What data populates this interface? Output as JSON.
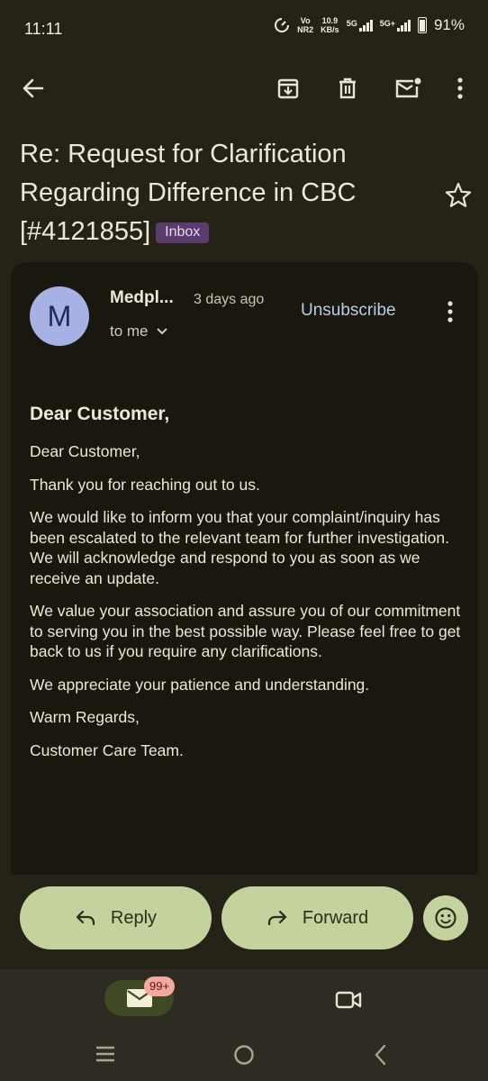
{
  "status_bar": {
    "time": "11:11",
    "volte_top": "Vo",
    "volte_bottom": "NR2",
    "speed_top": "10.9",
    "speed_bottom": "KB/s",
    "net1": "5G",
    "net2": "5G+",
    "battery": "91%"
  },
  "toolbar": {
    "back_icon": "arrow-left-icon",
    "archive_icon": "archive-icon",
    "delete_icon": "trash-icon",
    "unread_icon": "mark-unread-icon",
    "more_icon": "more-vertical-icon"
  },
  "email": {
    "subject": "Re: Request for Clarification Regarding Difference in CBC [#4121855]",
    "label": "Inbox",
    "avatar_letter": "M",
    "sender": "Medpl...",
    "time_ago": "3 days ago",
    "recipient": "to me",
    "unsubscribe": "Unsubscribe",
    "heading": "Dear Customer,",
    "paragraphs": [
      "Dear Customer,",
      "Thank you for reaching out to us.",
      "We would like to inform you that your complaint/inquiry has been escalated to the relevant team for further investigation. We will acknowledge and respond to you as soon as we receive an update.",
      "We value your association and assure you of our commitment to serving you in the best possible way. Please feel free to get back to us if you require any clarifications.",
      "We appreciate your patience and understanding.",
      "Warm Regards,",
      "Customer Care Team."
    ]
  },
  "actions": {
    "reply": "Reply",
    "forward": "Forward"
  },
  "bottom_nav": {
    "mail_badge": "99+"
  },
  "colors": {
    "background": "#252318",
    "card": "#19170e",
    "button": "#c4d29e",
    "avatar": "#a5b2e3",
    "label_chip": "#5a3d6e",
    "link": "#b8cce8"
  }
}
